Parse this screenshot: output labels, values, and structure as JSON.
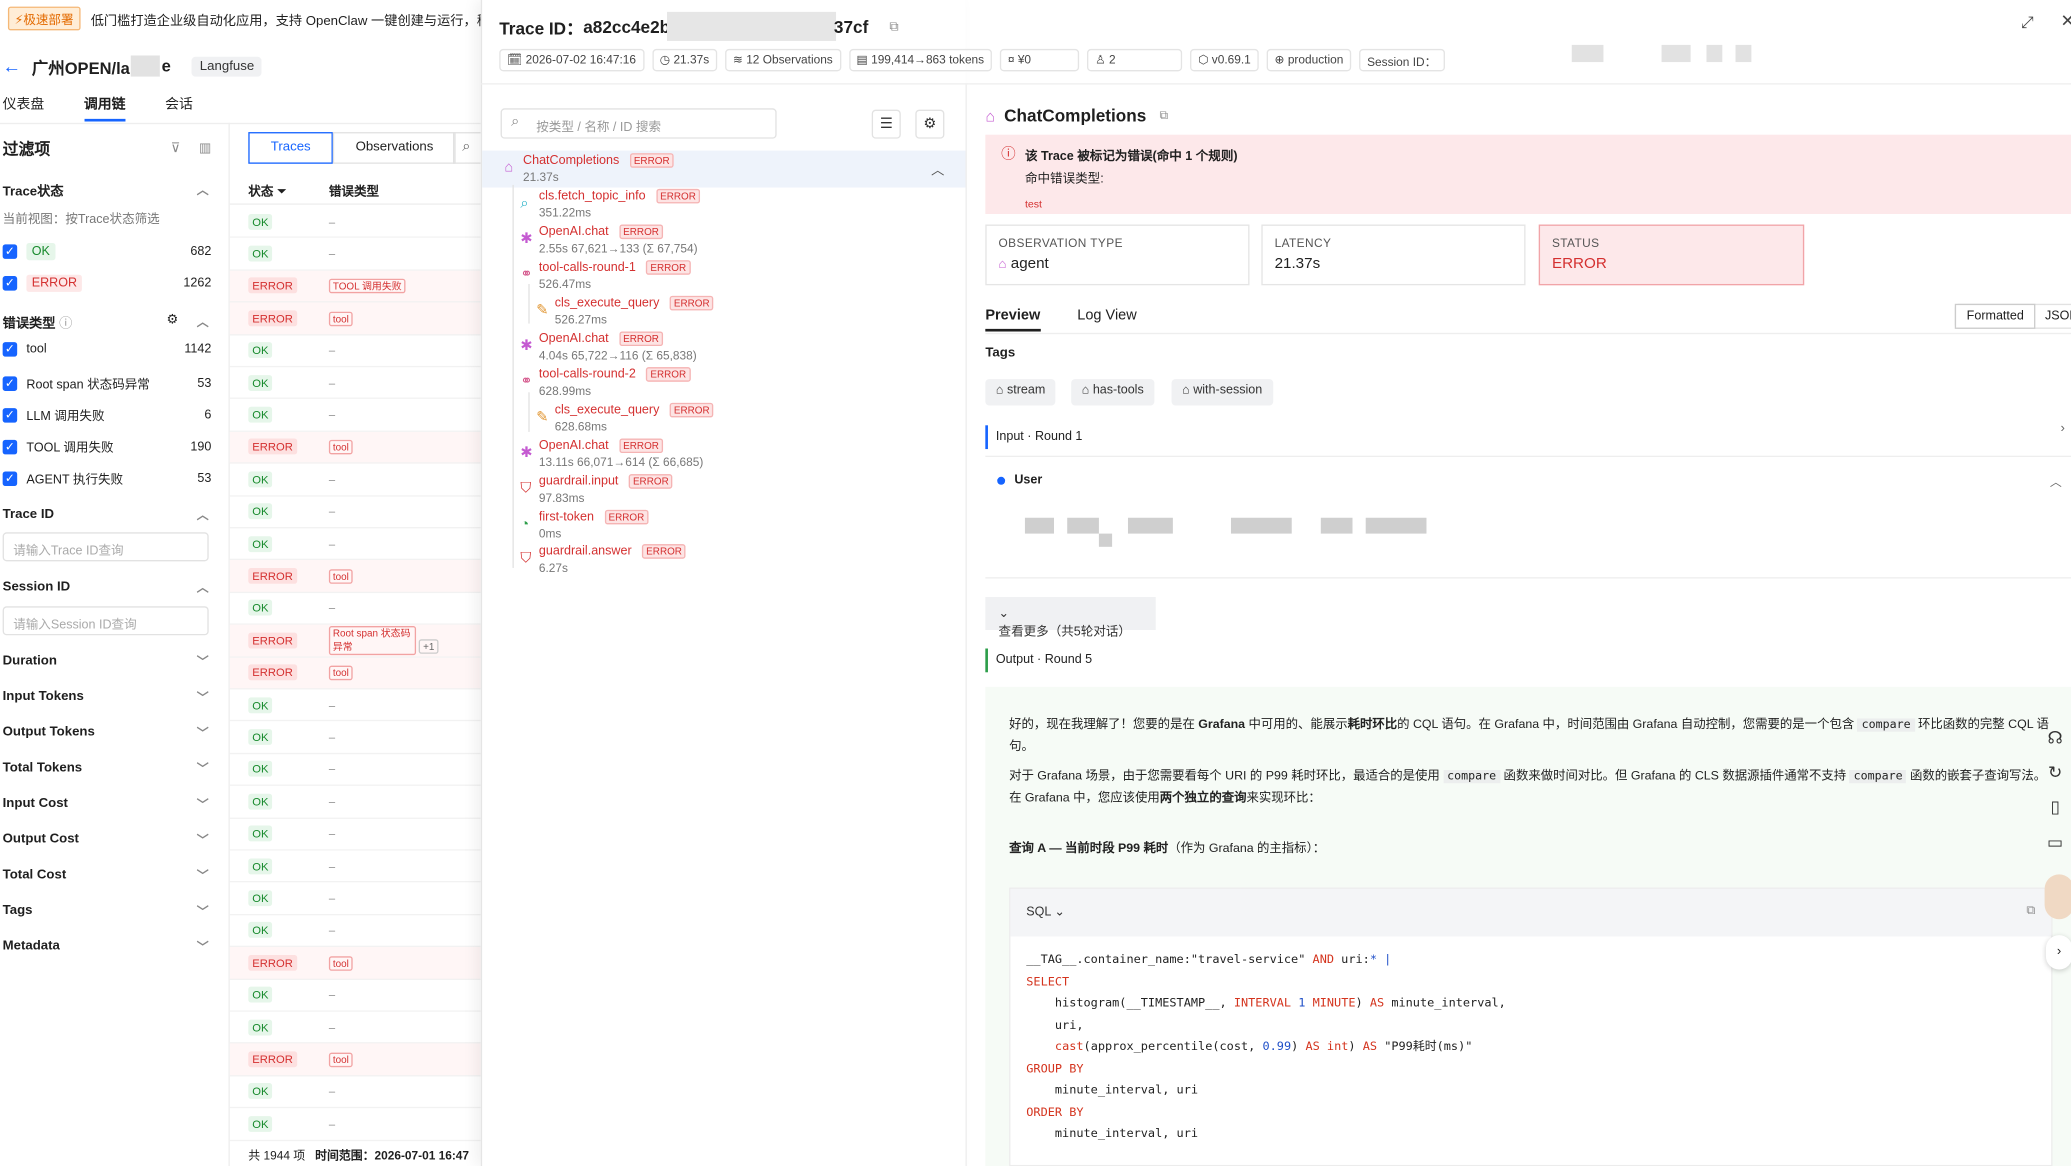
{
  "banner": {
    "tag": "⚡极速部署",
    "text": "低门槛打造企业级自动化应用，支持 OpenClaw 一键创建与运行，稳定高效"
  },
  "header": {
    "project": "广州OPEN/la",
    "project_suffix": "e",
    "product": "Langfuse"
  },
  "nav": [
    "仪表盘",
    "调用链",
    "会话"
  ],
  "filters": {
    "title": "过滤项",
    "trace_status": {
      "label": "Trace状态",
      "hint": "当前视图：按Trace状态筛选",
      "items": [
        {
          "label": "OK",
          "count": "682"
        },
        {
          "label": "ERROR",
          "count": "1262"
        }
      ]
    },
    "error_type": {
      "label": "错误类型",
      "items": [
        {
          "label": "tool",
          "count": "1142"
        },
        {
          "label": "Root span 状态码异常",
          "count": "53"
        },
        {
          "label": "LLM 调用失败",
          "count": "6"
        },
        {
          "label": "TOOL 调用失败",
          "count": "190"
        },
        {
          "label": "AGENT 执行失败",
          "count": "53"
        }
      ]
    },
    "trace_id": {
      "label": "Trace ID",
      "placeholder": "请输入Trace ID查询"
    },
    "session_id": {
      "label": "Session ID",
      "placeholder": "请输入Session ID查询"
    },
    "collapsed": [
      "Duration",
      "Input Tokens",
      "Output Tokens",
      "Total Tokens",
      "Input Cost",
      "Output Cost",
      "Total Cost",
      "Tags",
      "Metadata"
    ]
  },
  "list": {
    "tabs": [
      "Traces",
      "Observations"
    ],
    "columns": [
      "状态",
      "错误类型"
    ],
    "rows": [
      {
        "s": "OK",
        "t": "–"
      },
      {
        "s": "OK",
        "t": "–"
      },
      {
        "s": "ERROR",
        "t": "TOOL 调用失败"
      },
      {
        "s": "ERROR",
        "t": "tool"
      },
      {
        "s": "OK",
        "t": "–"
      },
      {
        "s": "OK",
        "t": "–"
      },
      {
        "s": "OK",
        "t": "–"
      },
      {
        "s": "ERROR",
        "t": "tool"
      },
      {
        "s": "OK",
        "t": "–"
      },
      {
        "s": "OK",
        "t": "–"
      },
      {
        "s": "OK",
        "t": "–"
      },
      {
        "s": "ERROR",
        "t": "tool"
      },
      {
        "s": "OK",
        "t": "–"
      },
      {
        "s": "ERROR",
        "t": "Root span 状态码异常",
        "extra": "+1"
      },
      {
        "s": "ERROR",
        "t": "tool"
      },
      {
        "s": "OK",
        "t": "–"
      },
      {
        "s": "OK",
        "t": "–"
      },
      {
        "s": "OK",
        "t": "–"
      },
      {
        "s": "OK",
        "t": "–"
      },
      {
        "s": "OK",
        "t": "–"
      },
      {
        "s": "OK",
        "t": "–"
      },
      {
        "s": "OK",
        "t": "–"
      },
      {
        "s": "OK",
        "t": "–"
      },
      {
        "s": "ERROR",
        "t": "tool"
      },
      {
        "s": "OK",
        "t": "–"
      },
      {
        "s": "OK",
        "t": "–"
      },
      {
        "s": "ERROR",
        "t": "tool"
      },
      {
        "s": "OK",
        "t": "–"
      },
      {
        "s": "OK",
        "t": "–"
      }
    ],
    "footer_count": "共 1944 项",
    "footer_range": "时间范围：2026-07-01 16:47"
  },
  "trace": {
    "title_prefix": "Trace ID：",
    "id_start": "a82cc4e2b",
    "id_end": "37cf",
    "meta": [
      "2026-07-02 16:47:16",
      "21.37s",
      "12 Observations",
      "199,414→863 tokens",
      "¥0",
      "2",
      "v0.69.1",
      "production",
      "Session ID："
    ],
    "search_placeholder": "按类型 / 名称 / ID 搜索",
    "tree": [
      {
        "name": "ChatCompletions",
        "sub": "21.37s",
        "icon": "agent-icon"
      },
      {
        "name": "cls.fetch_topic_info",
        "sub": "351.22ms",
        "icon": "search-icon"
      },
      {
        "name": "OpenAI.chat",
        "sub": "2.55s 67,621→133 (Σ 67,754)",
        "icon": "llm-icon"
      },
      {
        "name": "tool-calls-round-1",
        "sub": "526.47ms",
        "icon": "link-icon"
      },
      {
        "name": "cls_execute_query",
        "sub": "526.27ms",
        "icon": "tool-icon"
      },
      {
        "name": "OpenAI.chat",
        "sub": "4.04s 65,722→116 (Σ 65,838)",
        "icon": "llm-icon"
      },
      {
        "name": "tool-calls-round-2",
        "sub": "628.99ms",
        "icon": "link-icon"
      },
      {
        "name": "cls_execute_query",
        "sub": "628.68ms",
        "icon": "tool-icon"
      },
      {
        "name": "OpenAI.chat",
        "sub": "13.11s 66,071→614 (Σ 66,685)",
        "icon": "llm-icon"
      },
      {
        "name": "guardrail.input",
        "sub": "97.83ms",
        "icon": "shield-icon"
      },
      {
        "name": "first-token",
        "sub": "0ms",
        "icon": "event-icon"
      },
      {
        "name": "guardrail.answer",
        "sub": "6.27s",
        "icon": "shield-icon"
      }
    ],
    "error_label": "ERROR"
  },
  "detail": {
    "title": "ChatCompletions",
    "alert_title": "该 Trace 被标记为错误(命中 1 个规则)",
    "alert_sub": "命中错误类型:",
    "alert_code": "test",
    "cards": [
      {
        "k": "OBSERVATION TYPE",
        "v": "agent"
      },
      {
        "k": "LATENCY",
        "v": "21.37s"
      },
      {
        "k": "STATUS",
        "v": "ERROR"
      }
    ],
    "tabs": [
      "Preview",
      "Log View"
    ],
    "format": [
      "Formatted",
      "JSON"
    ],
    "tags_label": "Tags",
    "tags": [
      "stream",
      "has-tools",
      "with-session"
    ],
    "input_label": "Input · Round 1",
    "user_label": "User",
    "more_label": "查看更多（共5轮对话）",
    "output_label": "Output · Round 5",
    "p1_a": "好的，现在我理解了！您要的是在 ",
    "p1_b": "Grafana",
    "p1_c": " 中可用的、能展示",
    "p1_d": "耗时环比",
    "p1_e": "的 CQL 语句。在 Grafana 中，时间范围由 Grafana 自动控制，您需要的是一个包含 ",
    "p1_code": "compare",
    "p1_f": " 环比函数的完整 CQL 语句。",
    "p2_a": "对于 Grafana 场景，由于您需要看每个 URI 的 P99 耗时环比，最适合的是使用 ",
    "p2_code1": "compare",
    "p2_b": " 函数来做时间对比。但 Grafana 的 CLS 数据源插件通常不支持 ",
    "p2_code2": "compare",
    "p2_c": " 函数的嵌套子查询写法。在 Grafana 中，您应该使用",
    "p2_d": "两个独立的查询",
    "p2_e": "来实现环比：",
    "p3_a": "查询 A — 当前时段 P99 耗时",
    "p3_b": "（作为 Grafana 的主指标）：",
    "sql_lang": "SQL"
  }
}
